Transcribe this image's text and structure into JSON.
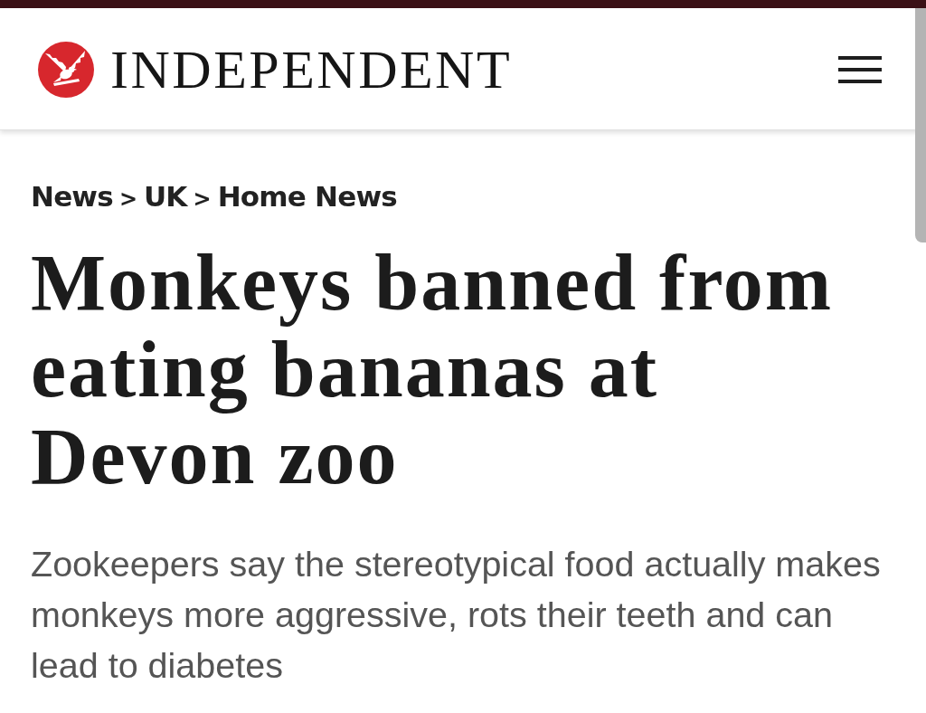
{
  "header": {
    "logo_text": "INDEPENDENT"
  },
  "breadcrumb": [
    {
      "label": "News",
      "separator": ">"
    },
    {
      "label": "UK",
      "separator": ">"
    },
    {
      "label": "Home News"
    }
  ],
  "article": {
    "headline": "Monkeys banned from eating bananas at Devon zoo",
    "standfirst": "Zookeepers say the stereotypical food actually makes monkeys more aggressive, rots their teeth and can lead to diabetes"
  }
}
